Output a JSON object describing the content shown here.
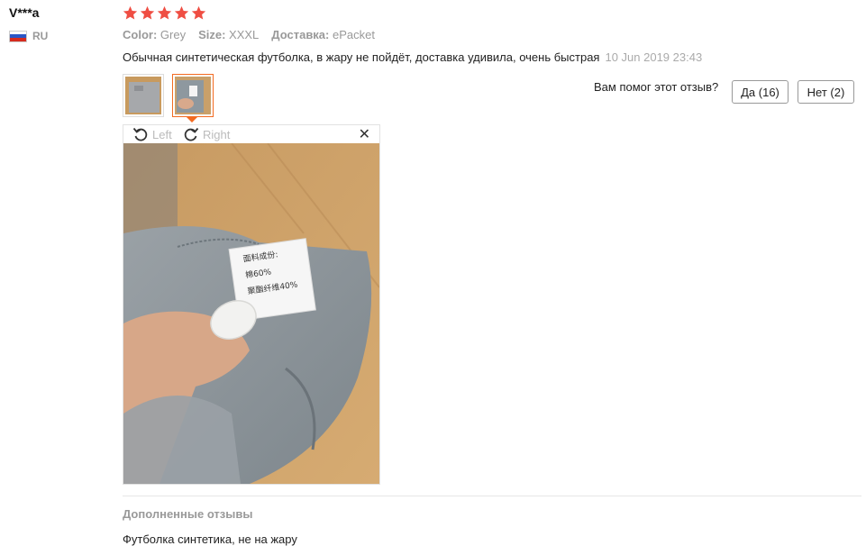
{
  "user": {
    "name": "V***a",
    "country_code": "RU",
    "flag_colors": [
      "#ffffff",
      "#2a56c6",
      "#d52b1e"
    ]
  },
  "rating": {
    "stars": 5,
    "max": 5,
    "color": "#ef4e43"
  },
  "attributes": {
    "color_label": "Color:",
    "color_value": "Grey",
    "size_label": "Size:",
    "size_value": "XXXL",
    "shipping_label": "Доставка:",
    "shipping_value": "ePacket"
  },
  "review": {
    "text": "Обычная синтетическая футболка, в жару не пойдёт, доставка удивила, очень быстрая",
    "date": "10 Jun 2019 23:43"
  },
  "thumbnails": [
    {
      "name": "photo-1",
      "active": false
    },
    {
      "name": "photo-2",
      "active": true
    }
  ],
  "helpful": {
    "question": "Вам помог этот отзыв?",
    "yes_label": "Да (16)",
    "no_label": "Нет (2)"
  },
  "viewer": {
    "rotate_left_label": "Left",
    "rotate_right_label": "Right",
    "close_icon": "close-icon",
    "tag_lines": [
      "面料成份:",
      "棉60%",
      "聚酯纤维40%"
    ]
  },
  "followup": {
    "title": "Дополненные отзывы",
    "text": "Футболка синтетика, не на жару"
  },
  "colors": {
    "accent": "#f36b21",
    "muted": "#999999"
  }
}
